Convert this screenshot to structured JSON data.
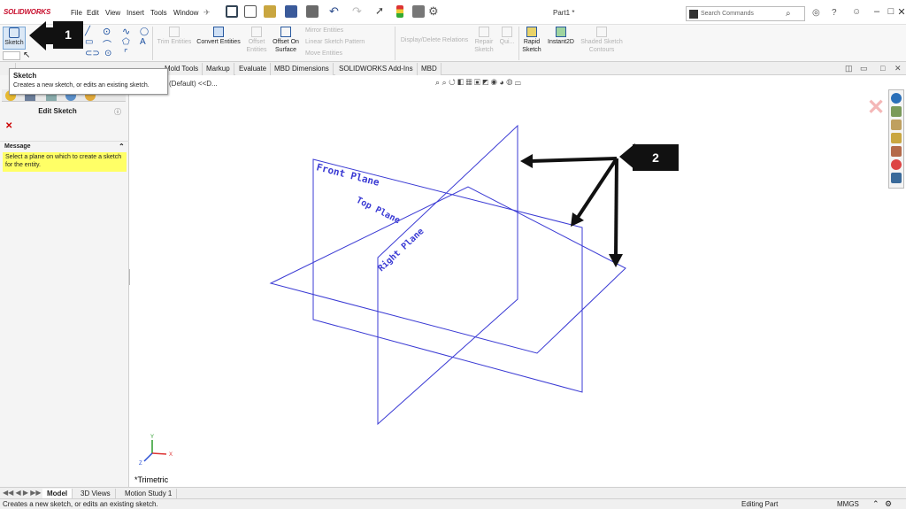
{
  "app": {
    "logo_text": "SOLIDWORKS",
    "doc_title": "Part1 *"
  },
  "menu": [
    "File",
    "Edit",
    "View",
    "Insert",
    "Tools",
    "Window"
  ],
  "search": {
    "placeholder": "Search Commands"
  },
  "commands": {
    "sketch": "Sketch",
    "trim": "Trim Entities",
    "convert": "Convert Entities",
    "offset": "Offset Entities",
    "offset_surface": "Offset On Surface",
    "mirror": "Mirror Entities",
    "linear_pattern": "Linear Sketch Pattern",
    "move": "Move Entities",
    "display_delete": "Display/Delete Relations",
    "repair": "Repair Sketch",
    "quick": "Qui...",
    "rapid": "Rapid Sketch",
    "instant2d": "Instant2D",
    "shaded": "Shaded Sketch Contours"
  },
  "tabs": [
    "Mold Tools",
    "Markup",
    "Evaluate",
    "MBD Dimensions",
    "SOLIDWORKS Add-Ins",
    "MBD"
  ],
  "tooltip": {
    "title": "Sketch",
    "desc": "Creates a new sketch, or edits an existing sketch."
  },
  "panel": {
    "title": "Edit Sketch",
    "message_header": "Message",
    "message_text": "Select a plane on which to create a sketch for the entity."
  },
  "viewport": {
    "tree_crumb": "(Default) <<D...",
    "view_name": "*Trimetric"
  },
  "planes": {
    "front": "Front Plane",
    "top": "Top Plane",
    "right": "Right Plane"
  },
  "annotations": {
    "callout1": "1",
    "callout2": "2"
  },
  "bottom_tabs": [
    "Model",
    "3D Views",
    "Motion Study 1"
  ],
  "status": {
    "left": "Creates a new sketch, or edits an existing sketch.",
    "editing": "Editing Part",
    "units": "MMGS"
  },
  "axes": {
    "y": "Y",
    "x": "X",
    "z": "Z"
  },
  "colors": {
    "plane_line": "#3b3bd4",
    "message_bg": "#ffff66",
    "callout": "#111111"
  }
}
